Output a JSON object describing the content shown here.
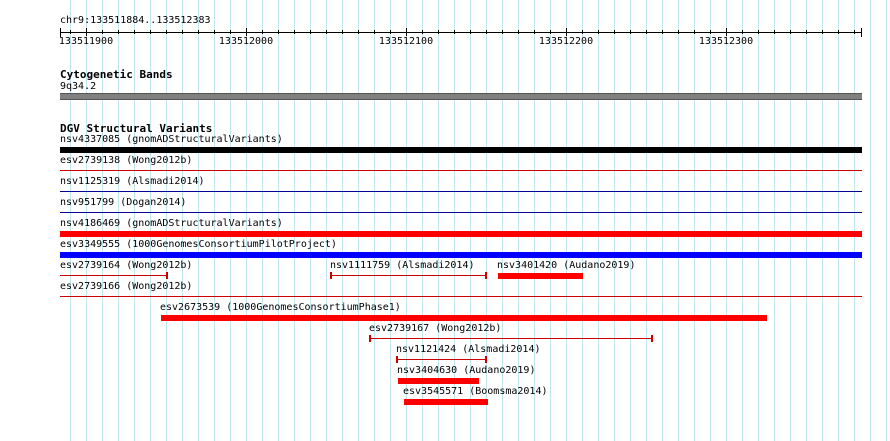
{
  "ruler": {
    "location": "chr9:133511884..133512383",
    "ticks": [
      "133511900",
      "133512000",
      "133512100",
      "133512200",
      "133512300"
    ]
  },
  "cytobands": {
    "title": "Cytogenetic Bands",
    "band": "9q34.2",
    "color": "#808080"
  },
  "dgv": {
    "title": "DGV Structural Variants",
    "features": [
      {
        "label": "nsv4337085 (gnomADStructuralVariants)",
        "color": "#000000"
      },
      {
        "label": "esv2739138 (Wong2012b)",
        "color": "#cc0000"
      },
      {
        "label": "nsv1125319 (Alsmadi2014)",
        "color": "#000099"
      },
      {
        "label": "nsv951799 (Dogan2014)",
        "color": "#000099"
      },
      {
        "label": "nsv4186469 (gnomADStructuralVariants)",
        "color": "#ff0000"
      },
      {
        "label": "esv3349555 (1000GenomesConsortiumPilotProject)",
        "color": "#0000ff"
      },
      {
        "label": "esv2739164 (Wong2012b)",
        "color": "#cc0000"
      },
      {
        "label": "nsv1111759 (Alsmadi2014)",
        "color": "#cc0000"
      },
      {
        "label": "nsv3401420 (Audano2019)",
        "color": "#ff0000"
      },
      {
        "label": "esv2739166 (Wong2012b)",
        "color": "#cc0000"
      },
      {
        "label": "esv2673539 (1000GenomesConsortiumPhase1)",
        "color": "#ff0000"
      },
      {
        "label": "esv2739167 (Wong2012b)",
        "color": "#cc0000"
      },
      {
        "label": "nsv1121424 (Alsmadi2014)",
        "color": "#cc0000"
      },
      {
        "label": "nsv3404630 (Audano2019)",
        "color": "#ff0000"
      },
      {
        "label": "esv3545571 (Boomsma2014)",
        "color": "#ff0000"
      }
    ]
  }
}
